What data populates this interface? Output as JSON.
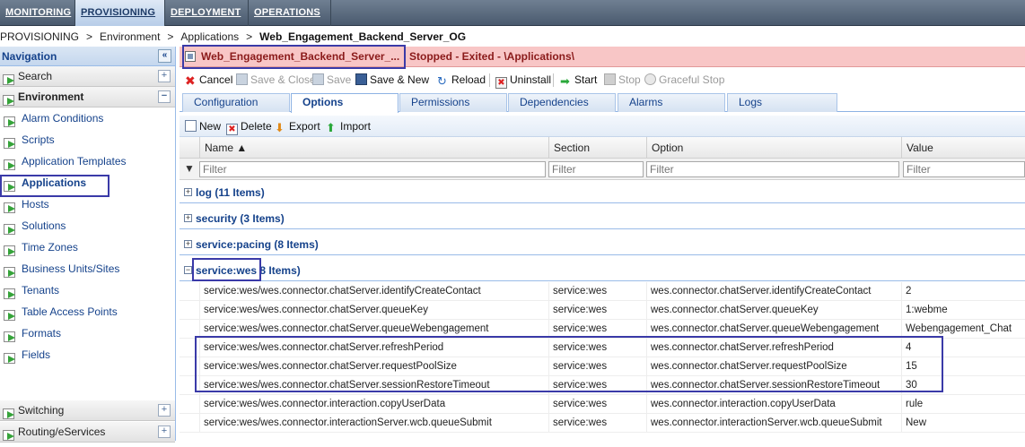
{
  "topmenu": {
    "items": [
      {
        "label": "MONITORING"
      },
      {
        "label": "PROVISIONING"
      },
      {
        "label": "DEPLOYMENT"
      },
      {
        "label": "OPERATIONS"
      }
    ]
  },
  "breadcrumb": {
    "items": [
      "PROVISIONING",
      "Environment",
      "Applications"
    ],
    "current": "Web_Engagement_Backend_Server_OG",
    "separator": ">"
  },
  "navigation": {
    "title": "Navigation",
    "collapse_glyph": "«",
    "search_label": "Search",
    "environment_label": "Environment",
    "items": [
      {
        "label": "Alarm Conditions"
      },
      {
        "label": "Scripts"
      },
      {
        "label": "Application Templates"
      },
      {
        "label": "Applications"
      },
      {
        "label": "Hosts"
      },
      {
        "label": "Solutions"
      },
      {
        "label": "Time Zones"
      },
      {
        "label": "Business Units/Sites"
      },
      {
        "label": "Tenants"
      },
      {
        "label": "Table Access Points"
      },
      {
        "label": "Formats"
      },
      {
        "label": "Fields"
      }
    ],
    "switching_label": "Switching",
    "routing_label": "Routing/eServices",
    "plus_glyph": "+",
    "minus_glyph": "−"
  },
  "object": {
    "title": "Web_Engagement_Backend_Server_...",
    "status": "Stopped - Exited - \\Applications\\"
  },
  "toolbar": {
    "cancel": "Cancel",
    "save_close": "Save & Close",
    "save": "Save",
    "save_new": "Save & New",
    "reload": "Reload",
    "uninstall": "Uninstall",
    "start": "Start",
    "stop": "Stop",
    "graceful_stop": "Graceful Stop"
  },
  "tabs": [
    {
      "label": "Configuration"
    },
    {
      "label": "Options"
    },
    {
      "label": "Permissions"
    },
    {
      "label": "Dependencies"
    },
    {
      "label": "Alarms"
    },
    {
      "label": "Logs"
    }
  ],
  "grid_toolbar": {
    "new": "New",
    "delete": "Delete",
    "export": "Export",
    "import": "Import"
  },
  "grid": {
    "columns": [
      "Name ▲",
      "Section",
      "Option",
      "Value"
    ],
    "filter_placeholder": "Filter",
    "groups": [
      {
        "label": "log",
        "count": "(11 Items)"
      },
      {
        "label": "security",
        "count": "(3 Items)"
      },
      {
        "label": "service:pacing",
        "count": "(8 Items)"
      },
      {
        "label": "service:wes",
        "count": "8 Items)"
      }
    ],
    "rows": [
      {
        "name": "service:wes/wes.connector.chatServer.identifyCreateContact",
        "section": "service:wes",
        "option": "wes.connector.chatServer.identifyCreateContact",
        "value": "2"
      },
      {
        "name": "service:wes/wes.connector.chatServer.queueKey",
        "section": "service:wes",
        "option": "wes.connector.chatServer.queueKey",
        "value": "1:webme"
      },
      {
        "name": "service:wes/wes.connector.chatServer.queueWebengagement",
        "section": "service:wes",
        "option": "wes.connector.chatServer.queueWebengagement",
        "value": "Webengagement_Chat"
      },
      {
        "name": "service:wes/wes.connector.chatServer.refreshPeriod",
        "section": "service:wes",
        "option": "wes.connector.chatServer.refreshPeriod",
        "value": "4"
      },
      {
        "name": "service:wes/wes.connector.chatServer.requestPoolSize",
        "section": "service:wes",
        "option": "wes.connector.chatServer.requestPoolSize",
        "value": "15"
      },
      {
        "name": "service:wes/wes.connector.chatServer.sessionRestoreTimeout",
        "section": "service:wes",
        "option": "wes.connector.chatServer.sessionRestoreTimeout",
        "value": "30"
      },
      {
        "name": "service:wes/wes.connector.interaction.copyUserData",
        "section": "service:wes",
        "option": "wes.connector.interaction.copyUserData",
        "value": "rule"
      },
      {
        "name": "service:wes/wes.connector.interactionServer.wcb.queueSubmit",
        "section": "service:wes",
        "option": "wes.connector.interactionServer.wcb.queueSubmit",
        "value": "New"
      }
    ]
  },
  "colors": {
    "highlight_box": "#3a3aa8",
    "status_bar": "#f8c6c6",
    "accent": "#15428b"
  }
}
